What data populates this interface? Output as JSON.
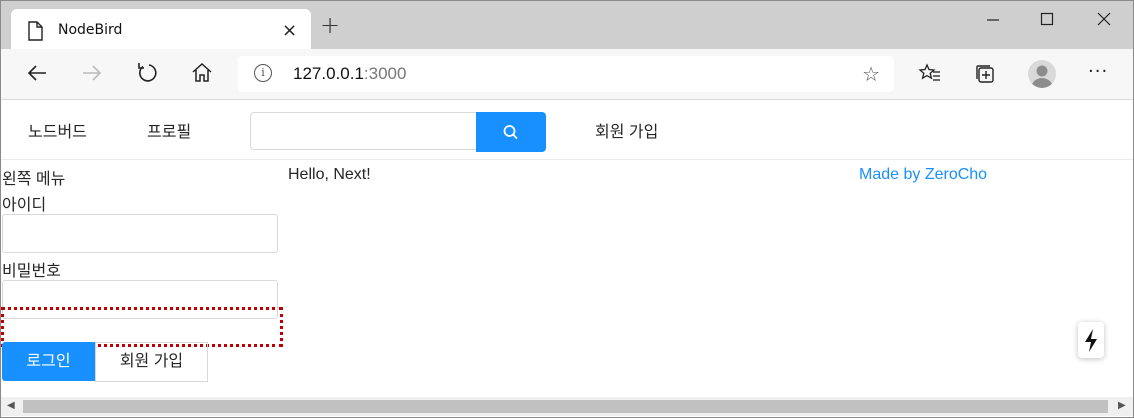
{
  "browser": {
    "tab_title": "NodeBird",
    "tab_close": "×",
    "new_tab": "+",
    "url_host": "127.0.0.1",
    "url_port": ":3000",
    "info_glyph": "i",
    "more_glyph": "···"
  },
  "menu": {
    "items": [
      "노드버드",
      "프로필",
      "회원 가입"
    ]
  },
  "sidebar": {
    "title": "왼쪽 메뉴",
    "id_label": "아이디",
    "password_label": "비밀번호",
    "login_button": "로그인",
    "signup_button": "회원 가입"
  },
  "main": {
    "greeting": "Hello, Next!"
  },
  "aside": {
    "credit": "Made by ZeroCho"
  },
  "colors": {
    "accent": "#1890ff",
    "highlight_border": "#c00000"
  }
}
